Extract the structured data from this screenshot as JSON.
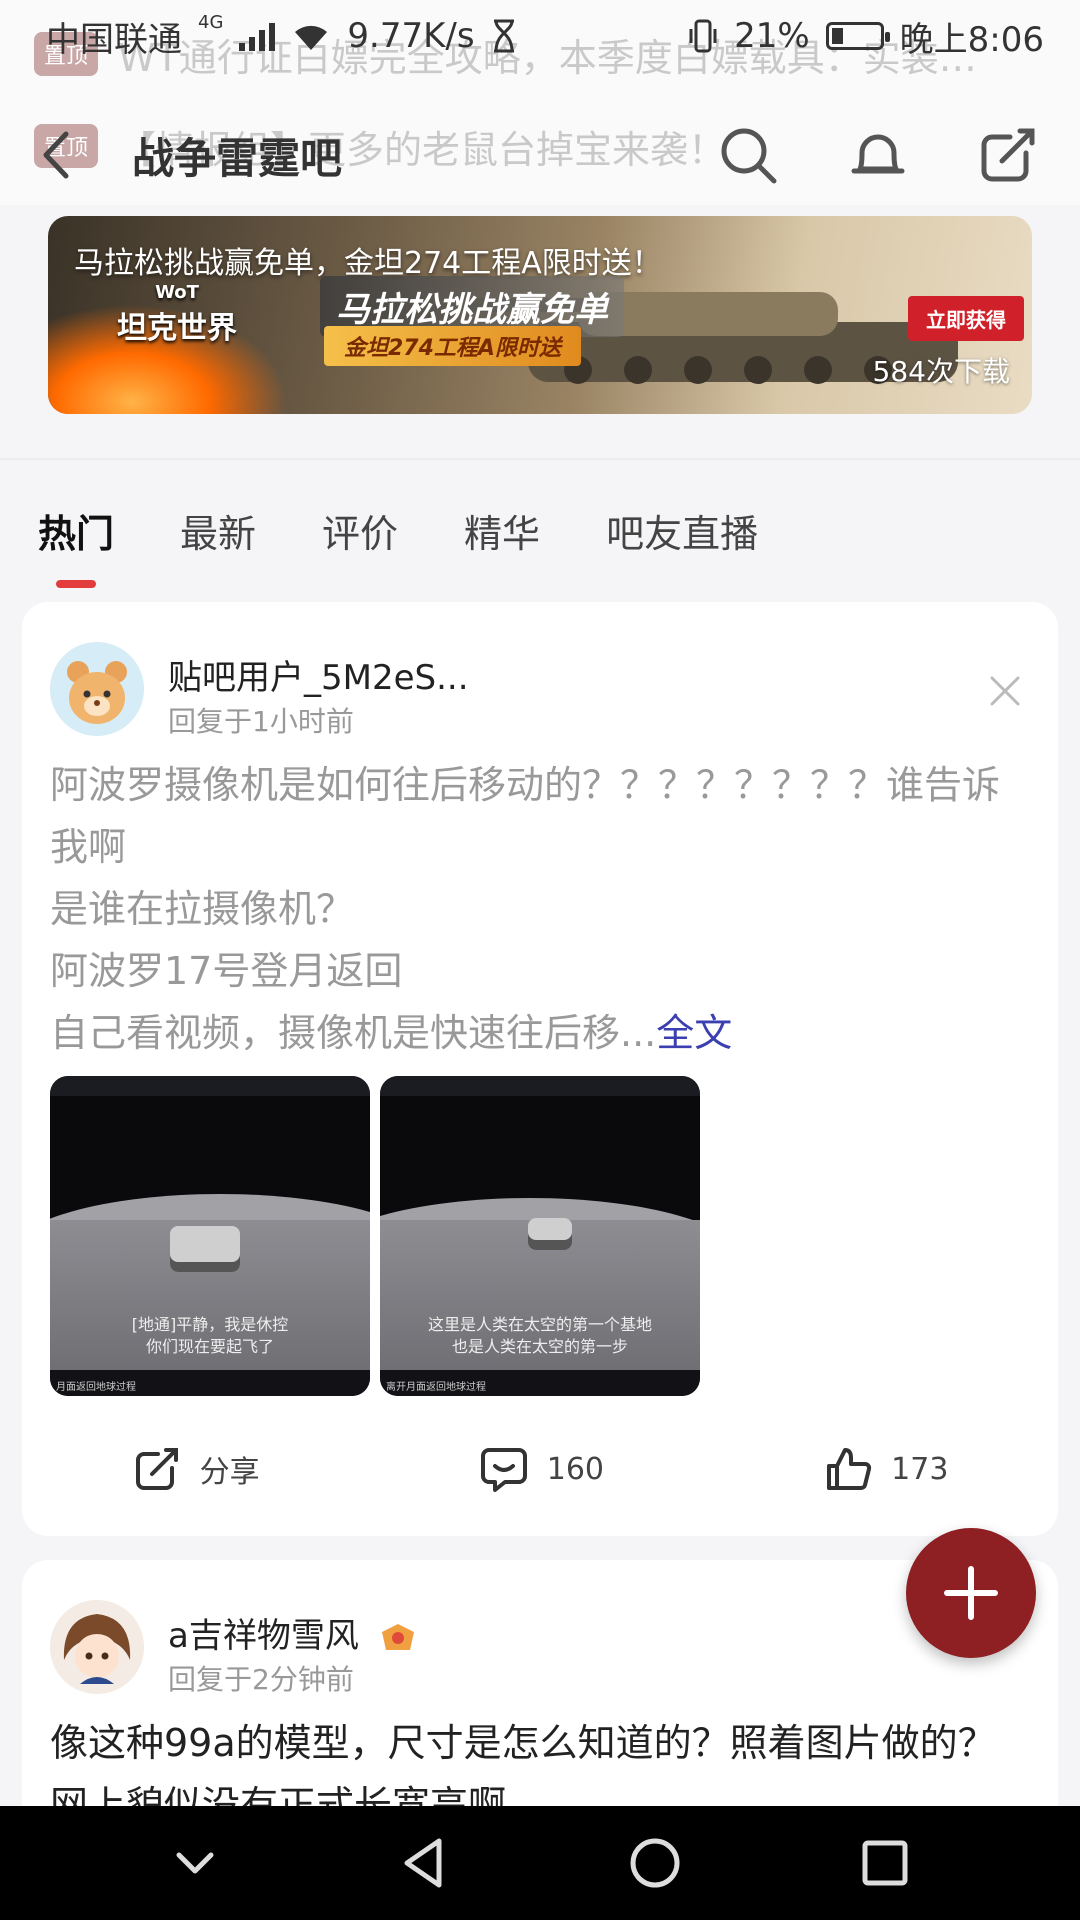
{
  "status_bar": {
    "carrier": "中国联通",
    "network": "4G",
    "speed": "9.77K/s",
    "battery": "21%",
    "time": "晚上8:06"
  },
  "pinned": [
    {
      "tag": "置顶",
      "text": "WT通行证白嫖完全攻略，本季度白嫖载具：实装…"
    },
    {
      "tag": "置顶",
      "text": "【情报组】更多的老鼠台掉宝来袭！"
    }
  ],
  "header": {
    "title": "战争雷霆吧",
    "icons": [
      "search-icon",
      "bell-icon",
      "share-icon"
    ]
  },
  "banner": {
    "headline": "马拉松挑战赢免单，金坦274工程A限时送！",
    "logo_text": "坦克世界",
    "promo_main": "马拉松挑战赢免单",
    "promo_sub": "金坦274工程A限时送",
    "cta": "立即获得",
    "downloads": "584次下载"
  },
  "tabs": [
    {
      "label": "热门",
      "active": true
    },
    {
      "label": "最新",
      "active": false
    },
    {
      "label": "评价",
      "active": false
    },
    {
      "label": "精华",
      "active": false
    },
    {
      "label": "吧友直播",
      "active": false
    }
  ],
  "posts": [
    {
      "user": "贴吧用户_5M2eS...",
      "time": "回复于1小时前",
      "body": "阿波罗摄像机是如何往后移动的？？？？？？？？谁告诉我啊\n是谁在拉摄像机？\n阿波罗17号登月返回\n自己看视频，摄像机是快速往后移...",
      "more": "全文",
      "images": [
        {
          "caption": "[地通]平静，我是休控\n你们现在要起飞了",
          "footer": "月面返回地球过程"
        },
        {
          "caption": "这里是人类在太空的第一个基地\n也是人类在太空的第一步",
          "footer": "离开月面返回地球过程"
        }
      ],
      "actions": {
        "share_label": "分享",
        "comments": "160",
        "likes": "173"
      }
    },
    {
      "user": "a吉祥物雪风",
      "time": "回复于2分钟前",
      "body": "像这种99a的模型，尺寸是怎么知道的？照着图片做的？网上貌似没有正式长宽高啊"
    }
  ],
  "colors": {
    "accent_red": "#e33c3c",
    "fab": "#8e1f22",
    "link": "#3b3fb0"
  }
}
